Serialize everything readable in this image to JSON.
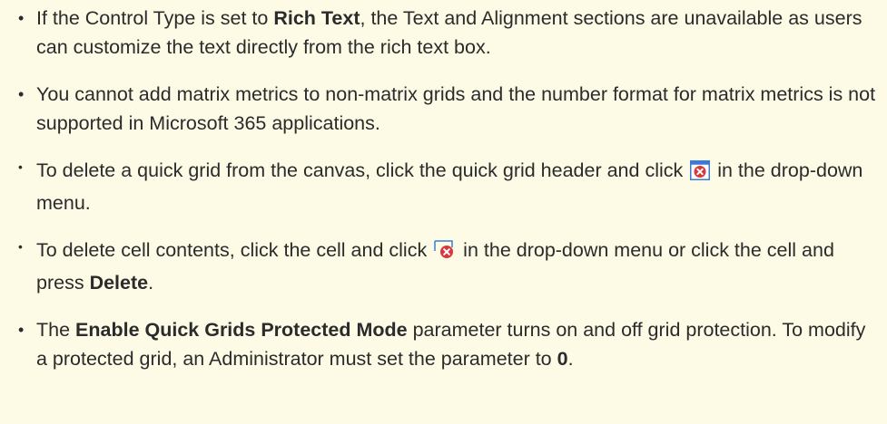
{
  "notes": [
    {
      "t1": "If the Control Type is set to ",
      "b1": "Rich Text",
      "t2": ", the Text and Alignment sections are unavailable as users can customize the text directly from the rich text box."
    },
    {
      "t1": "You cannot add matrix metrics to non-matrix grids and the number format for matrix metrics is not supported in Microsoft 365 applications."
    },
    {
      "t1": "To delete a quick grid from the canvas, click the quick grid header and click",
      "icon": "delete-grid-icon",
      "t2": " in the drop-down menu."
    },
    {
      "t1": "To delete cell contents, click the cell and click",
      "icon": "clear-cell-icon",
      "t2": " in the drop-down menu or click the cell and press ",
      "b1": "Delete",
      "t3": "."
    },
    {
      "t1": "The ",
      "b1": "Enable Quick Grids Protected Mode",
      "t2": " parameter turns on and off grid protection. To modify a protected grid, an Administrator must set the parameter to ",
      "b2": "0",
      "t3": "."
    }
  ],
  "colors": {
    "background": "#fdfbe6",
    "text": "#2b2b2b",
    "icon_red": "#d9373d",
    "icon_blue": "#3a7bd5"
  }
}
